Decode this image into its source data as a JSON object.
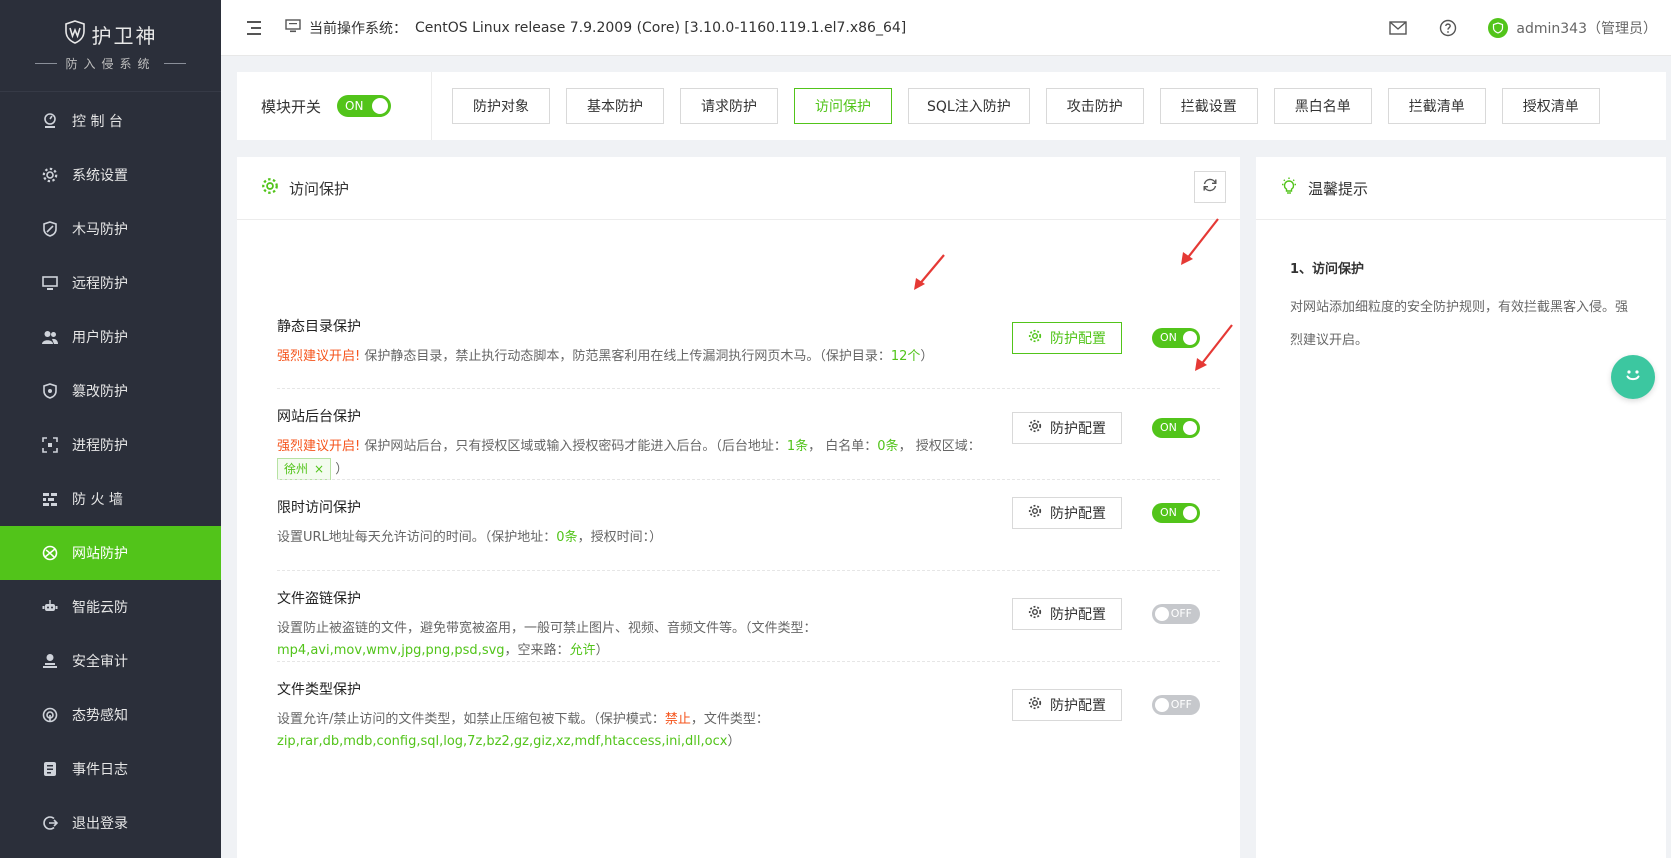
{
  "brand": {
    "title": "护卫神",
    "subtitle": "防入侵系统"
  },
  "sidebar": {
    "items": [
      {
        "label": "控 制 台",
        "icon": "dashboard-icon"
      },
      {
        "label": "系统设置",
        "icon": "gear-icon"
      },
      {
        "label": "木马防护",
        "icon": "shield-icon"
      },
      {
        "label": "远程防护",
        "icon": "monitor-icon"
      },
      {
        "label": "用户防护",
        "icon": "users-icon"
      },
      {
        "label": "篡改防护",
        "icon": "lock-icon"
      },
      {
        "label": "进程防护",
        "icon": "process-icon"
      },
      {
        "label": "防 火 墙",
        "icon": "firewall-icon"
      },
      {
        "label": "网站防护",
        "icon": "globe-icon",
        "active": true
      },
      {
        "label": "智能云防",
        "icon": "robot-icon"
      },
      {
        "label": "安全审计",
        "icon": "audit-icon"
      },
      {
        "label": "态势感知",
        "icon": "radar-icon"
      },
      {
        "label": "事件日志",
        "icon": "log-icon"
      },
      {
        "label": "退出登录",
        "icon": "logout-icon"
      }
    ]
  },
  "header": {
    "os_label": "当前操作系统：",
    "os_value": "CentOS Linux release 7.9.2009 (Core) [3.10.0-1160.119.1.el7.x86_64]",
    "user": "admin343（管理员）"
  },
  "module": {
    "label": "模块开关",
    "toggle": "ON"
  },
  "tabs": [
    {
      "label": "防护对象"
    },
    {
      "label": "基本防护"
    },
    {
      "label": "请求防护"
    },
    {
      "label": "访问保护",
      "active": true
    },
    {
      "label": "SQL注入防护"
    },
    {
      "label": "攻击防护"
    },
    {
      "label": "拦截设置"
    },
    {
      "label": "黑白名单"
    },
    {
      "label": "拦截清单"
    },
    {
      "label": "授权清单"
    }
  ],
  "panel": {
    "title": "访问保护",
    "config_label": "防护配置",
    "rows": [
      {
        "title": "静态目录保护",
        "warn": "强烈建议开启!",
        "desc": " 保护静态目录，禁止执行动态脚本，防范黑客利用在线上传漏洞执行网页木马。（保护目录：",
        "v1": "12个",
        "tail": "）",
        "toggle": "ON"
      },
      {
        "title": "网站后台保护",
        "warn": "强烈建议开启!",
        "desc": " 保护网站后台，只有授权区域或输入授权密码才能进入后台。（后台地址：",
        "v1": "1条",
        "mid1": "， 白名单：",
        "v2": "0条",
        "mid2": "， 授权区域：",
        "chip": "徐州",
        "tail": "）",
        "toggle": "ON"
      },
      {
        "title": "限时访问保护",
        "desc": "设置URL地址每天允许访问的时间。（保护地址：",
        "v1": "0条",
        "mid1": "，授权时间：",
        "tail": "）",
        "toggle": "ON"
      },
      {
        "title": "文件盗链保护",
        "desc": "设置防止被盗链的文件，避免带宽被盗用，一般可禁止图片、视频、音频文件等。（文件类型：",
        "v1": "mp4,avi,mov,wmv,jpg,png,psd,svg",
        "mid1": "，空来路：",
        "v2": "允许",
        "tail": "）",
        "toggle": "OFF"
      },
      {
        "title": "文件类型保护",
        "desc": "设置允许/禁止访问的文件类型，如禁止压缩包被下载。（保护模式：",
        "v1": "禁止",
        "mid1": "，文件类型：",
        "v2": "zip,rar,db,mdb,config,sql,log,7z,bz2,gz,giz,xz,mdf,htaccess,ini,dll,ocx",
        "tail": "）",
        "toggle": "OFF"
      }
    ]
  },
  "tips": {
    "title": "温馨提示",
    "subtitle": "1、访问保护",
    "text": "对网站添加细粒度的安全防护规则，有效拦截黑客入侵。强烈建议开启。"
  },
  "colors": {
    "accent": "#52c41a",
    "sidebar_bg": "#2b2f3a",
    "warn": "#f5541c"
  }
}
